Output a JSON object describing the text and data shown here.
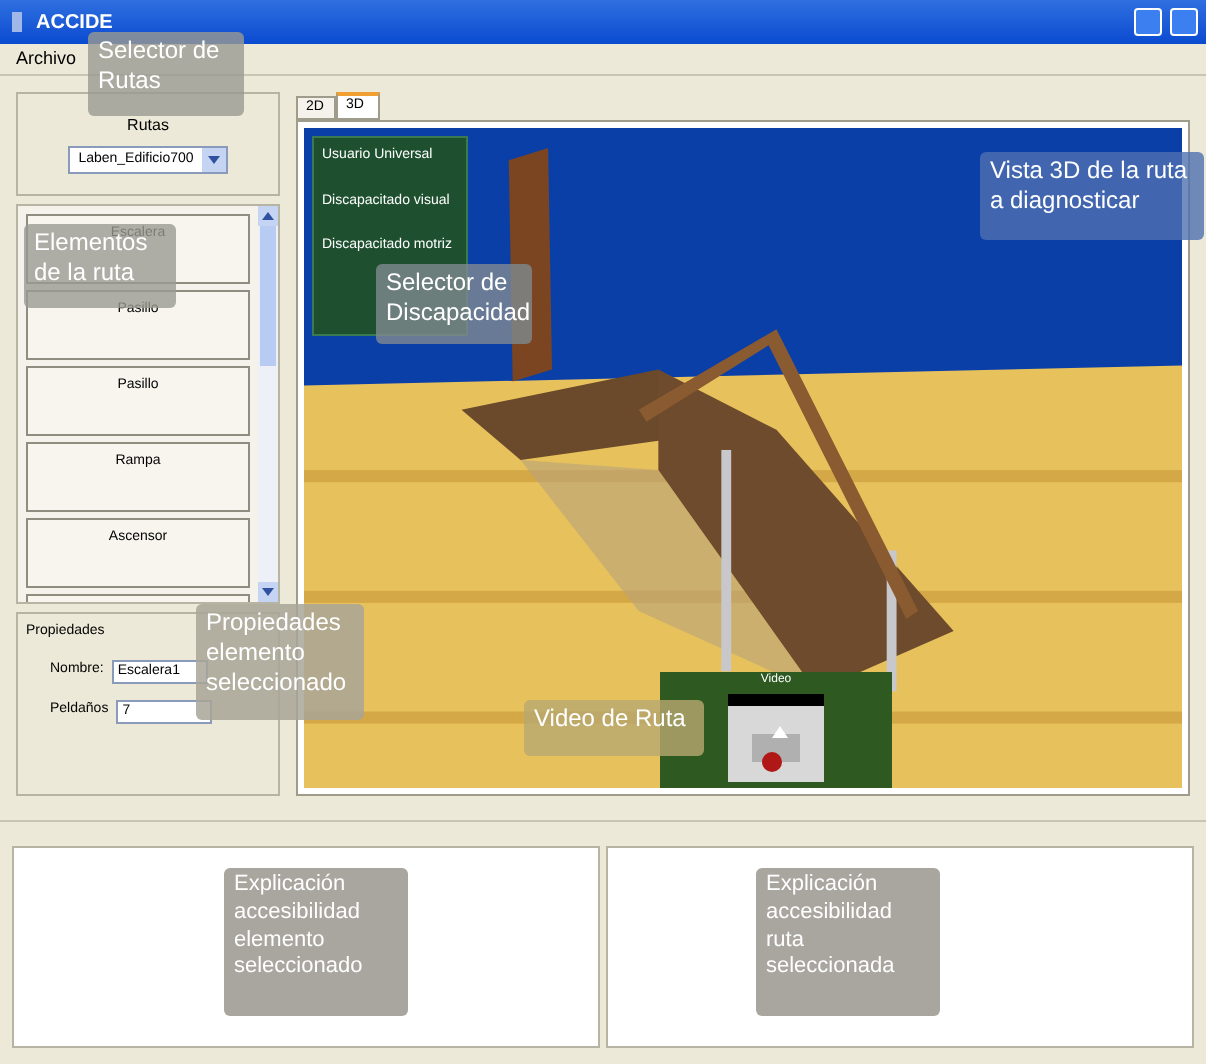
{
  "window": {
    "title": "ACCIDE"
  },
  "menu": [
    "Archivo"
  ],
  "routes": {
    "label": "Rutas",
    "value": "Laben_Edificio700"
  },
  "elements": [
    "Escalera",
    "Pasillo",
    "Pasillo",
    "Rampa",
    "Ascensor"
  ],
  "properties": {
    "title": "Propiedades",
    "fields": [
      {
        "label": "Nombre:",
        "value": "Escalera1"
      },
      {
        "label": "Peldaños",
        "value": "7"
      }
    ]
  },
  "tabs": [
    {
      "label": "2D",
      "selected": false
    },
    {
      "label": "3D",
      "selected": true
    }
  ],
  "disability_selector": [
    "Usuario Universal",
    "Discapacitado visual",
    "Discapacitado motriz"
  ],
  "video": {
    "title": "Video"
  },
  "callouts": [
    {
      "lines": [
        "Selector de",
        "Rutas"
      ]
    },
    {
      "lines": [
        "Elementos",
        "de la ruta"
      ]
    },
    {
      "lines": [
        "Selector de",
        "Discapacidad"
      ]
    },
    {
      "lines": [
        "Vista 3D de la ruta",
        "a diagnosticar"
      ]
    },
    {
      "lines": [
        "Propiedades",
        "elemento",
        "seleccionado"
      ]
    },
    {
      "lines": [
        "Video de Ruta"
      ]
    },
    {
      "lines": [
        "Explicación",
        "accesibilidad",
        "elemento",
        "seleccionado"
      ]
    },
    {
      "lines": [
        "Explicación",
        "accesibilidad",
        "ruta",
        "seleccionada"
      ]
    }
  ]
}
